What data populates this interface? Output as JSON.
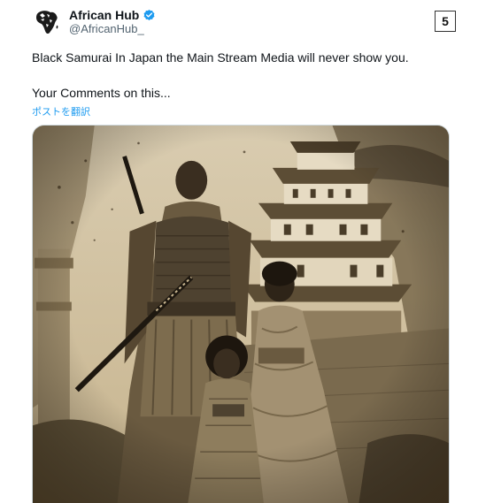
{
  "author": {
    "display_name": "African Hub",
    "handle": "@AfricanHub_"
  },
  "badge": "5",
  "tweet": {
    "line1": "Black Samurai In Japan the Main Stream Media will never show you.",
    "line2": "Your Comments on this...",
    "translate_link": "ポストを翻訳"
  },
  "colors": {
    "link": "#1d9bf0",
    "verified": "#1d9bf0",
    "sepia": "#c9b690"
  },
  "icons": {
    "avatar": "africa-map-avatar",
    "verified": "verified-badge-icon"
  }
}
